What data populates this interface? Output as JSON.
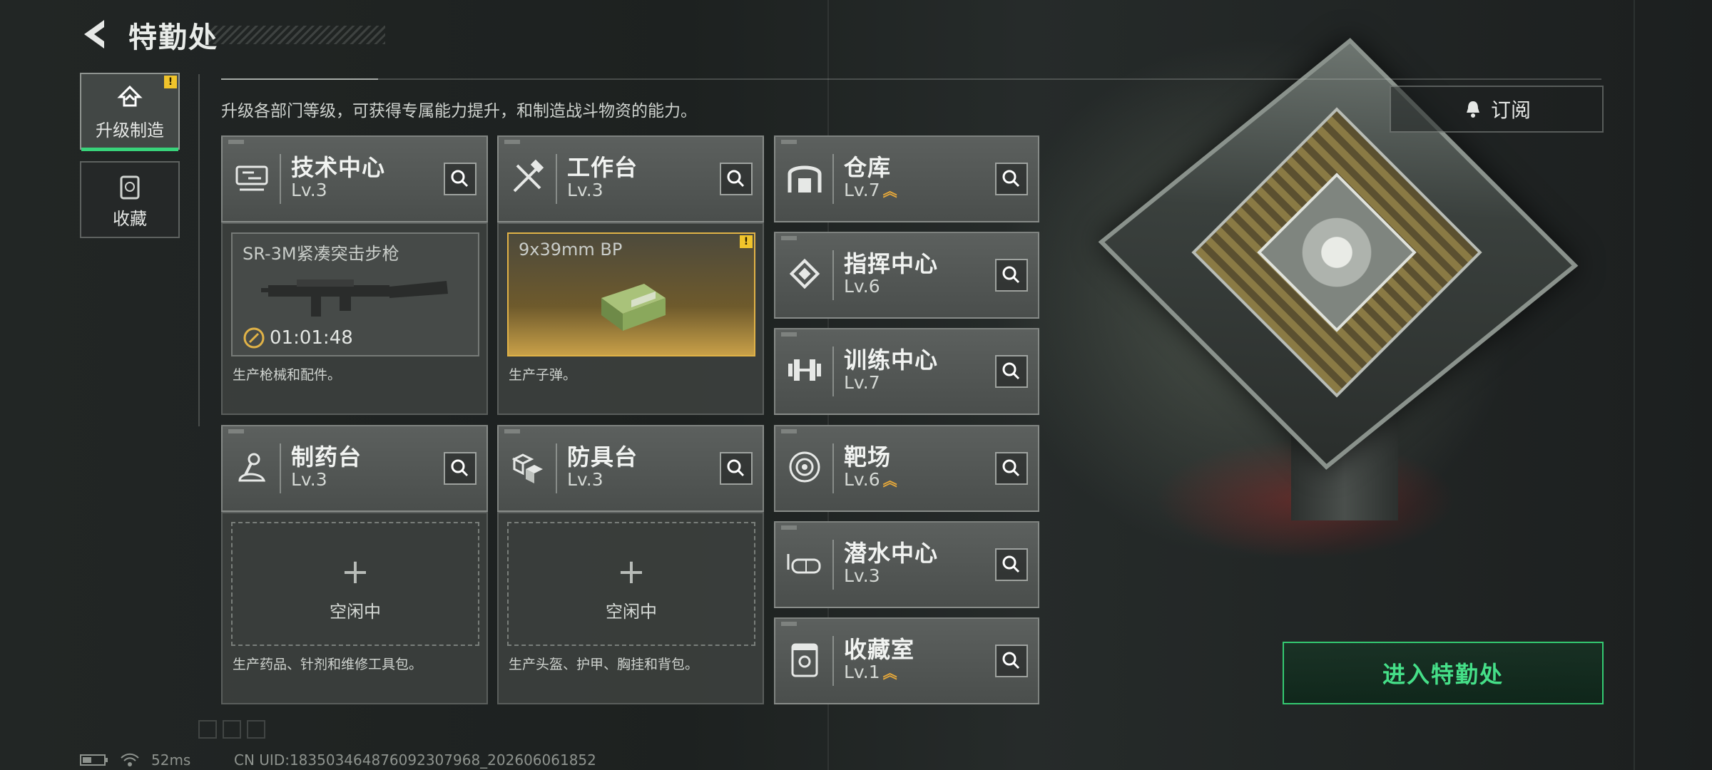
{
  "header": {
    "title": "特勤处"
  },
  "sidebar": {
    "items": [
      {
        "label": "升级制造",
        "active": true,
        "icon": "upgrade-icon",
        "alert": "!"
      },
      {
        "label": "收藏",
        "active": false,
        "icon": "collection-icon"
      }
    ]
  },
  "main": {
    "description": "升级各部门等级，可获得专属能力提升，和制造战斗物资的能力。",
    "subscribe_label": "订阅",
    "enter_label": "进入特勤处",
    "departments": [
      {
        "name": "技术中心",
        "level": "Lv.3",
        "icon": "tech-center-icon"
      },
      {
        "name": "工作台",
        "level": "Lv.3",
        "icon": "workbench-icon"
      },
      {
        "name": "仓库",
        "level": "Lv.7",
        "icon": "warehouse-icon",
        "upgradable": true
      },
      {
        "name": "指挥中心",
        "level": "Lv.6",
        "icon": "command-center-icon"
      },
      {
        "name": "训练中心",
        "level": "Lv.7",
        "icon": "training-center-icon"
      },
      {
        "name": "制药台",
        "level": "Lv.3",
        "icon": "pharmacy-icon"
      },
      {
        "name": "防具台",
        "level": "Lv.3",
        "icon": "armor-bench-icon"
      },
      {
        "name": "靶场",
        "level": "Lv.6",
        "icon": "shooting-range-icon",
        "upgradable": true
      },
      {
        "name": "潜水中心",
        "level": "Lv.3",
        "icon": "diving-center-icon"
      },
      {
        "name": "收藏室",
        "level": "Lv.1",
        "icon": "collection-room-icon",
        "upgradable": true
      }
    ],
    "production": [
      {
        "item": "SR-3M紧凑突击步枪",
        "timer": "01:01:48",
        "footer": "生产枪械和配件。"
      },
      {
        "item": "9x39mm BP",
        "footer": "生产子弹。",
        "alert": "!"
      },
      {
        "idle_label": "空闲中",
        "footer": "生产药品、针剂和维修工具包。"
      },
      {
        "idle_label": "空闲中",
        "footer": "生产头盔、护甲、胸挂和背包。"
      }
    ]
  },
  "status": {
    "ping": "52ms",
    "uid": "CN UID:183503464876092307968_202606061852"
  },
  "colors": {
    "accent_green": "#38d37a",
    "warning_yellow": "#f0c42b",
    "gold": "#e0b247"
  }
}
